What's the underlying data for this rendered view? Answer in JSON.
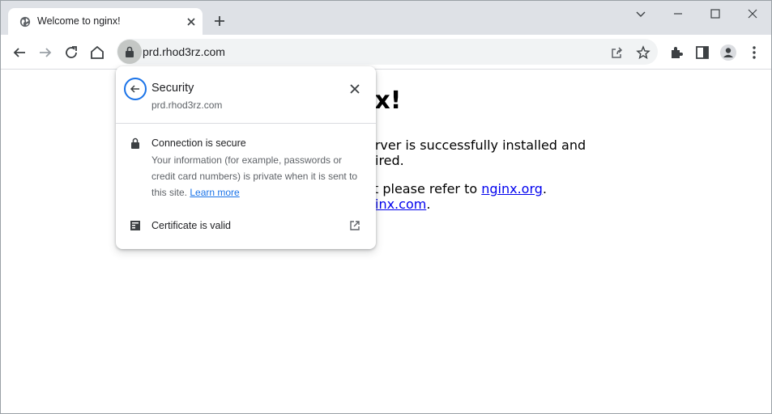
{
  "tab": {
    "title": "Welcome to nginx!"
  },
  "omnibox": {
    "url": "prd.rhod3rz.com"
  },
  "page": {
    "heading_visible": "nx!",
    "line1_a": "erver is successfully installed and",
    "line1_b": "ired.",
    "line2_prefix": "t please refer to ",
    "link1": "nginx.org",
    "line2_suffix": ".",
    "link2": "inx.com",
    "line3_suffix": "."
  },
  "popup": {
    "title": "Security",
    "subtitle": "prd.rhod3rz.com",
    "connection_title": "Connection is secure",
    "connection_desc": "Your information (for example, passwords or credit card numbers) is private when it is sent to this site.",
    "learn_more": "Learn more",
    "certificate": "Certificate is valid"
  },
  "icons": {
    "favicon": "globe-icon",
    "tab_close": "close-icon",
    "new_tab": "plus-icon",
    "back": "arrow-left-icon",
    "forward": "arrow-right-icon",
    "reload": "reload-icon",
    "home": "home-icon",
    "lock": "lock-icon",
    "share": "share-icon",
    "bookmark": "star-icon",
    "extensions": "puzzle-icon",
    "side_panel": "side-panel-icon",
    "profile": "profile-icon",
    "menu": "kebab-menu-icon",
    "certificate": "certificate-icon",
    "external": "external-link-icon"
  },
  "colors": {
    "tabstrip": "#dee1e6",
    "accent": "#1a73e8",
    "link": "#0000ee"
  }
}
